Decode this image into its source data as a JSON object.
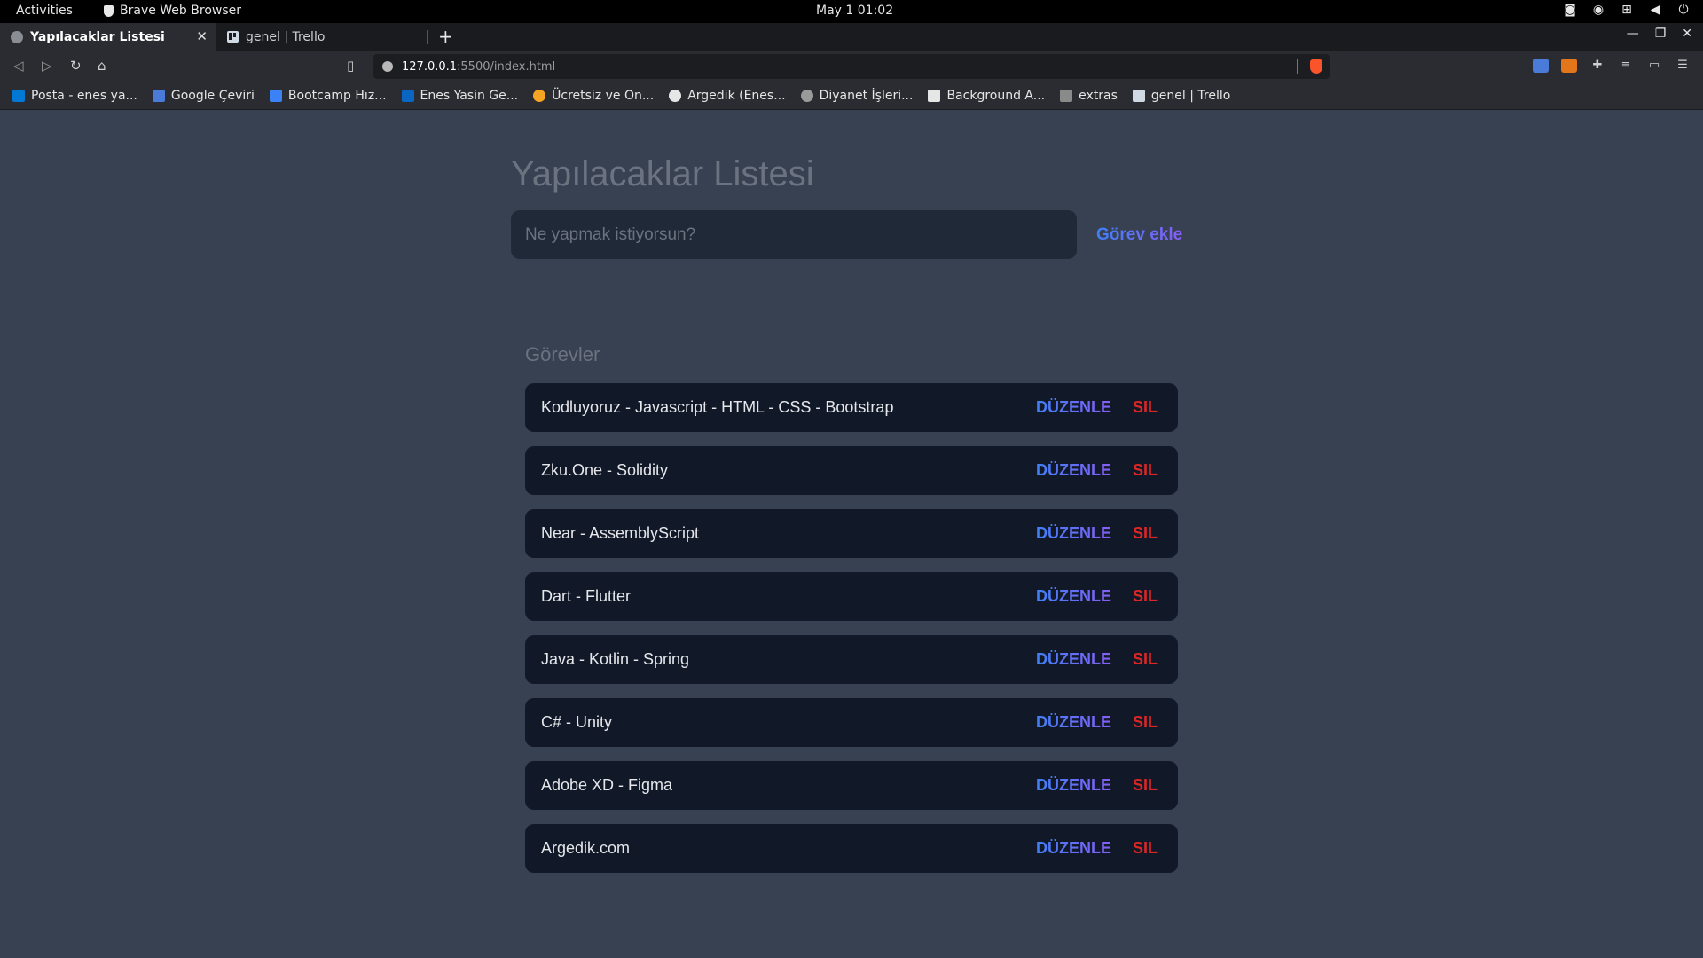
{
  "system_bar": {
    "activities": "Activities",
    "app_name": "Brave Web Browser",
    "clock": "May 1  01:02",
    "tray_icons": [
      "discord-icon",
      "steam-icon",
      "network-icon",
      "volume-icon",
      "power-icon"
    ]
  },
  "browser": {
    "tabs": [
      {
        "title": "Yapılacaklar Listesi",
        "active": true
      },
      {
        "title": "genel | Trello",
        "active": false
      }
    ],
    "url_host": "127.0.0.1",
    "url_path": ":5500/index.html",
    "bookmarks": [
      {
        "label": "Posta - enes ya...",
        "icon": "outlook-icon",
        "color": "#0078d4"
      },
      {
        "label": "Google Çeviri",
        "icon": "translate-icon",
        "color": "#4a7bd8"
      },
      {
        "label": "Bootcamp Hız...",
        "icon": "bootcamp-icon",
        "color": "#3b82f6"
      },
      {
        "label": "Enes Yasin Ge...",
        "icon": "linkedin-icon",
        "color": "#0a66c2"
      },
      {
        "label": "Ücretsiz ve On...",
        "icon": "circle-icon",
        "color": "#f5a524"
      },
      {
        "label": "Argedik (Enes...",
        "icon": "github-icon",
        "color": "#e6e6e6"
      },
      {
        "label": "Diyanet İşleri...",
        "icon": "globe-icon",
        "color": "#9a9a9a"
      },
      {
        "label": "Background A...",
        "icon": "notion-icon",
        "color": "#e6e6e6"
      },
      {
        "label": "extras",
        "icon": "folder-icon",
        "color": "#8a8a8a"
      },
      {
        "label": "genel | Trello",
        "icon": "trello-icon",
        "color": "#cfd8e3"
      }
    ]
  },
  "app": {
    "title": "Yapılacaklar Listesi",
    "input_placeholder": "Ne yapmak istiyorsun?",
    "add_button": "Görev ekle",
    "tasks_heading": "Görevler",
    "edit_label": "DÜZENLE",
    "delete_label": "SIL",
    "tasks": [
      "Kodluyoruz - Javascript - HTML - CSS - Bootstrap",
      "Zku.One - Solidity",
      "Near - AssemblyScript",
      "Dart - Flutter",
      "Java - Kotlin - Spring",
      "C# - Unity",
      "Adobe XD - Figma",
      "Argedik.com"
    ]
  },
  "colors": {
    "page_bg": "#374151",
    "card_bg": "#111827",
    "accent_gradient_start": "#3b82f6",
    "accent_gradient_end": "#8b5cf6",
    "danger": "#dc2626"
  }
}
